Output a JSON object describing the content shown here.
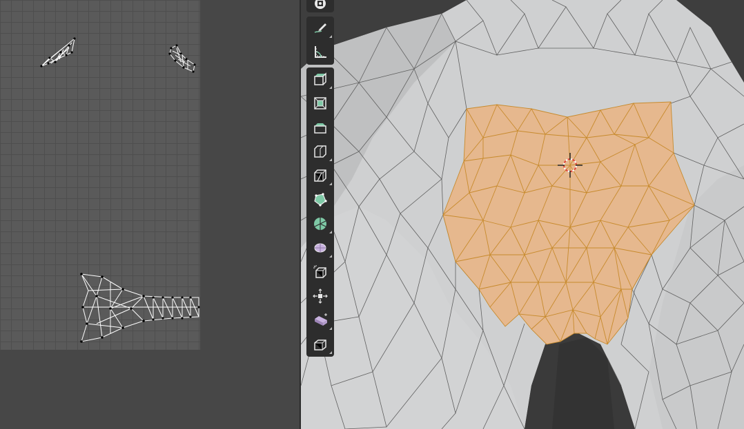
{
  "colors": {
    "uv_background": "#5a5a5a",
    "uv_grid_lines": "#4e4e4e",
    "panel_background": "#474747",
    "viewport_background": "#3e3e3e",
    "mesh_surface": "#cfd0d1",
    "selected_faces": "#e6b88e",
    "selected_edges": "#c78a2c",
    "wire": "#5a5a5a",
    "axis_y": "#6ab04c",
    "axis_x": "#c0504d",
    "toolbar_bg": "#2d2d2d",
    "tool_accent": "#7ec9a6"
  },
  "uv_editor": {
    "islands": [
      "uv-island-arm-left",
      "uv-island-arm-right",
      "uv-island-pelvis"
    ]
  },
  "toolbar": {
    "tools": [
      {
        "name": "tweak-tool",
        "icon": "cursor-icon"
      },
      {
        "name": "annotate-tool",
        "icon": "pencil-icon"
      },
      {
        "name": "measure-tool",
        "icon": "ruler-icon"
      },
      {
        "name": "add-cube-tool",
        "icon": "cube-add-icon"
      },
      {
        "name": "extrude-region-tool",
        "icon": "extrude-icon"
      },
      {
        "name": "inset-faces-tool",
        "icon": "inset-icon"
      },
      {
        "name": "bevel-tool",
        "icon": "bevel-icon"
      },
      {
        "name": "loop-cut-tool",
        "icon": "loop-cut-icon"
      },
      {
        "name": "knife-tool",
        "icon": "knife-icon"
      },
      {
        "name": "poly-build-tool",
        "icon": "poly-build-icon"
      },
      {
        "name": "spin-tool",
        "icon": "spin-icon"
      },
      {
        "name": "smooth-tool",
        "icon": "smooth-icon"
      },
      {
        "name": "edge-slide-tool",
        "icon": "edge-slide-icon"
      },
      {
        "name": "shrink-fatten-tool",
        "icon": "shrink-fatten-icon"
      },
      {
        "name": "shear-tool",
        "icon": "shear-icon"
      },
      {
        "name": "rip-region-tool",
        "icon": "rip-icon"
      }
    ]
  }
}
